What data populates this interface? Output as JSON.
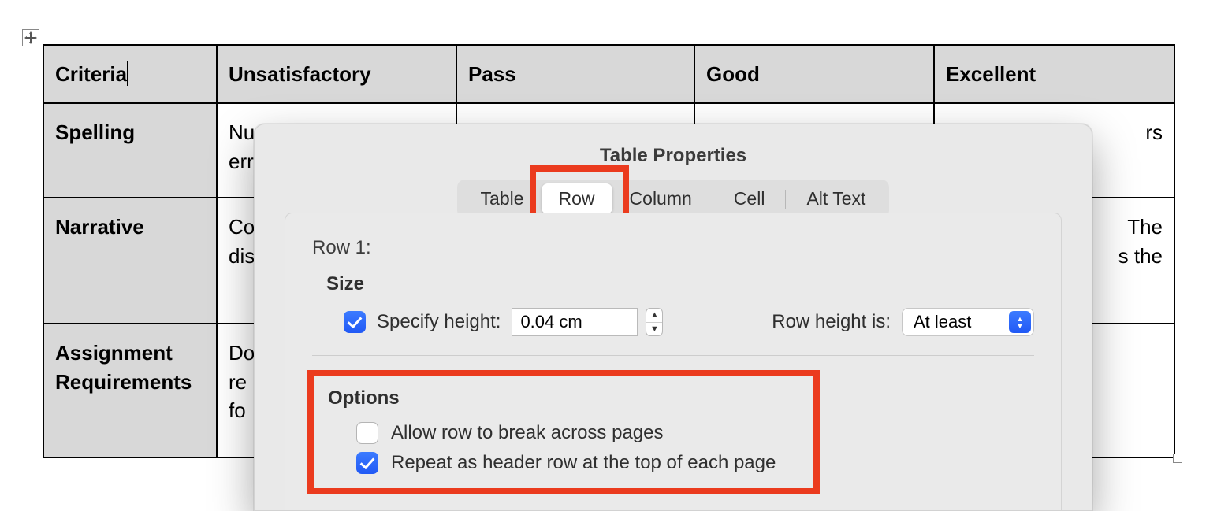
{
  "table": {
    "headers": [
      "Criteria",
      "Unsatisfactory",
      "Pass",
      "Good",
      "Excellent"
    ],
    "rows": [
      {
        "label": "Spelling",
        "cells": [
          "Nu",
          "",
          "",
          "rs"
        ],
        "prefix_row1": "err"
      },
      {
        "label": "Narrative",
        "cells": [
          "Co",
          "",
          "",
          "The"
        ],
        "prefix_row2": "dis",
        "suffix_row2": "s the"
      },
      {
        "label": "Assignment Requirements",
        "cells": [
          "Do",
          "",
          "",
          ""
        ],
        "prefix_row2": "re",
        "prefix_row3": "fo"
      }
    ]
  },
  "dialog": {
    "title": "Table Properties",
    "tabs": {
      "table": "Table",
      "row": "Row",
      "column": "Column",
      "cell": "Cell",
      "alt_text": "Alt Text"
    },
    "row_label": "Row 1:",
    "size_title": "Size",
    "specify_height_label": "Specify height:",
    "height_value": "0.04 cm",
    "row_height_is_label": "Row height is:",
    "row_height_is_value": "At least",
    "options_title": "Options",
    "allow_break_label": "Allow row to break across pages",
    "repeat_header_label": "Repeat as header row at the top of each page",
    "specify_height_checked": true,
    "allow_break_checked": false,
    "repeat_header_checked": true
  },
  "icons": {
    "move": "move-icon",
    "resize": "resize-icon",
    "up": "▲",
    "down": "▼"
  }
}
